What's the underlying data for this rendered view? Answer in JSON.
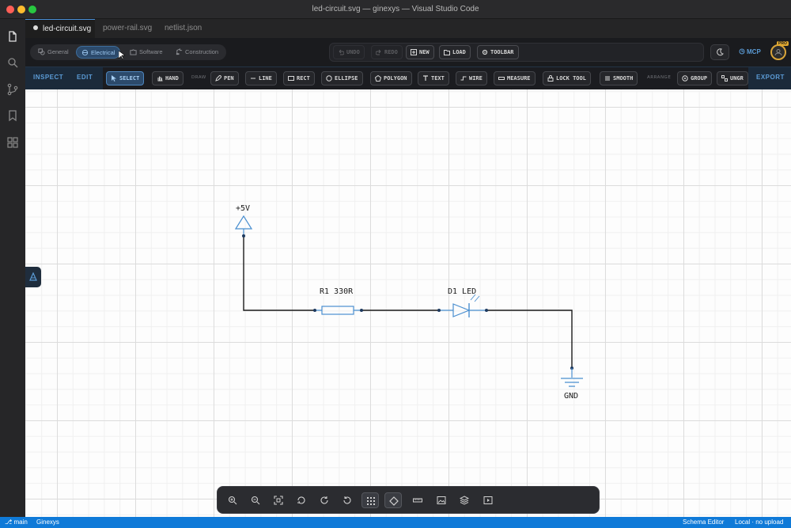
{
  "window": {
    "title": "led-circuit.svg — ginexys — Visual Studio Code"
  },
  "tabs": [
    {
      "label": "led-circuit.svg",
      "active": true,
      "modified": true
    },
    {
      "label": "power-rail.svg",
      "active": false
    },
    {
      "label": "netlist.json",
      "active": false
    }
  ],
  "mode_tabs": [
    {
      "label": "General",
      "icon": "shapes-icon"
    },
    {
      "label": "Electrical",
      "icon": "circuit-icon",
      "active": true
    },
    {
      "label": "Software",
      "icon": "puzzle-icon"
    },
    {
      "label": "Construction",
      "icon": "crane-icon"
    }
  ],
  "actions": {
    "undo": "UNDO",
    "redo": "REDO",
    "new": "NEW",
    "load": "LOAD",
    "toolbar": "TOOLBAR"
  },
  "header_right": {
    "mcp": "MCP",
    "pro_badge": "PRO"
  },
  "tool_row": {
    "inspect": "INSPECT",
    "edit": "EDIT",
    "export": "EXPORT",
    "group_draw": "DRAW",
    "group_arrange": "ARRANGE",
    "tools": {
      "select": "SELECT",
      "hand": "HAND",
      "pen": "PEN",
      "line": "LINE",
      "rect": "RECT",
      "ellipse": "ELLIPSE",
      "polygon": "POLYGON",
      "text": "TEXT",
      "wire": "WIRE",
      "measure": "MEASURE",
      "lock_tool": "LOCK TOOL",
      "smooth": "SMOOTH",
      "group": "GROUP",
      "ungroup": "UNGR"
    }
  },
  "schematic": {
    "vcc_label": "+5V",
    "resistor_label": "R1 330R",
    "led_label": "D1 LED",
    "gnd_label": "GND",
    "colors": {
      "component": "#4a8fd0",
      "wire": "#1a1a1a",
      "node": "#1e3a5f"
    }
  },
  "statusbar": {
    "branch": "main",
    "project": "Ginexys",
    "editor_mode": "Schema Editor",
    "sync": "Local · no upload"
  },
  "colors": {
    "accent": "#5b9bd5",
    "statusbar": "#0f7ad8",
    "active_tool": "#2c4a6b"
  }
}
